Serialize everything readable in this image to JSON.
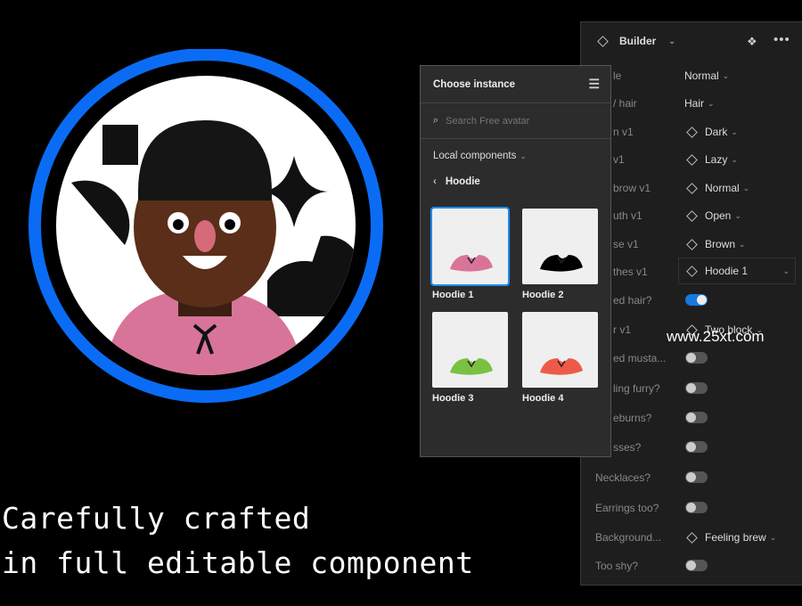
{
  "tagline": {
    "line1": "Carefully crafted",
    "line2": "in full editable component"
  },
  "watermark": "www.25xt.com",
  "colors": {
    "ring": "#0a6cf5",
    "toggle_on": "#1778e0",
    "hoodie": [
      "#d97499",
      "#000000",
      "#7ac142",
      "#ee5a4a"
    ]
  },
  "builder": {
    "title": "Builder",
    "rows": [
      {
        "label": "le",
        "value": "Normal",
        "type": "select"
      },
      {
        "label": "/ hair",
        "value": "Hair",
        "type": "select"
      },
      {
        "label": "n v1",
        "value": "Dark",
        "type": "instance"
      },
      {
        "label": "v1",
        "value": "Lazy",
        "type": "instance"
      },
      {
        "label": "brow v1",
        "value": "Normal",
        "type": "instance"
      },
      {
        "label": "uth v1",
        "value": "Open",
        "type": "instance"
      },
      {
        "label": "se v1",
        "value": "Brown",
        "type": "instance"
      },
      {
        "label": "thes v1",
        "value": "Hoodie 1",
        "type": "instance-selected"
      },
      {
        "label": "ed hair?",
        "value": true,
        "type": "toggle"
      },
      {
        "label": "r v1",
        "value": "Two block",
        "type": "instance"
      },
      {
        "label": "ed musta...",
        "value": false,
        "type": "toggle"
      },
      {
        "label": "ling furry?",
        "value": false,
        "type": "toggle"
      },
      {
        "label": "eburns?",
        "value": false,
        "type": "toggle"
      },
      {
        "label": "sses?",
        "value": false,
        "type": "toggle"
      },
      {
        "label": "Necklaces?",
        "value": false,
        "type": "toggle"
      },
      {
        "label": "Earrings too?",
        "value": false,
        "type": "toggle"
      },
      {
        "label": "Background...",
        "value": "Feeling brew",
        "type": "instance"
      },
      {
        "label": "Too shy?",
        "value": false,
        "type": "toggle"
      }
    ]
  },
  "popup": {
    "title": "Choose instance",
    "search_placeholder": "Search Free avatar",
    "library": "Local components",
    "folder": "Hoodie",
    "items": [
      {
        "name": "Hoodie 1",
        "selected": true
      },
      {
        "name": "Hoodie 2"
      },
      {
        "name": "Hoodie 3"
      },
      {
        "name": "Hoodie 4"
      }
    ]
  }
}
